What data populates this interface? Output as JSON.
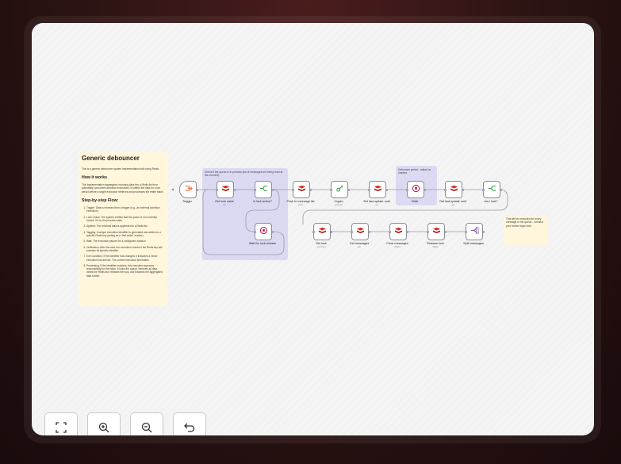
{
  "notes": {
    "main": {
      "title": "Generic debouncer",
      "intro": "This is a generic debouncer system implementation built using Redis.",
      "how_title": "How it works",
      "how_body": "This implementation aggregates incoming data into a Redis list from potentially concurrent workflow executions. It buffers the data for a set period before a single execution retrieves and processes the entire batch.",
      "steps_title": "Step-by-step Flow:",
      "steps": [
        "Trigger: Data is received from a trigger (e.g., an external workflow execution).",
        "Lock Check: The system verifies that the queue is not currently locked. If it is, the process waits.",
        "Append: The received data is appended to a Redis list.",
        "Tagging: A unique execution identifier is generated and written to a specific Redis key (acting as a \"last writer\" marker).",
        "Wait: The execution pauses for a configured duration.",
        "Verification: After the wait, the execution checks if the Redis key still contains its specific identifier.",
        "Exit Condition: If the identifier has changed, it indicates a newer execution has arrived. The current execution terminates.",
        "Processing: If the identifier matches, this execution assumes responsibility for the batch. It locks the queue, retrieves all data, clears the Redis list, releases the lock, and forwards the aggregated data further."
      ]
    },
    "queue_group": "Check if the queue is in process (list of messages are being read at the moment)",
    "wait_group": "Debounce period - adjust as needed",
    "final": "This will be executed for every message in the queue - connect your further logic here"
  },
  "nodes": [
    {
      "id": "trigger",
      "label": "Trigger",
      "sub": "",
      "icon": "trigger-icon"
    },
    {
      "id": "get-lock",
      "label": "Get lock value",
      "sub": "get",
      "icon": "redis-icon"
    },
    {
      "id": "is-lock-active",
      "label": "Is lock active?",
      "sub": "",
      "icon": "if-icon"
    },
    {
      "id": "wait-lock",
      "label": "Wait for lock release",
      "sub": "",
      "icon": "wait-icon"
    },
    {
      "id": "push",
      "label": "Push to message list",
      "sub": "push",
      "icon": "redis-icon"
    },
    {
      "id": "crypto",
      "label": "Crypto",
      "sub": "generate",
      "icon": "key-icon"
    },
    {
      "id": "set-last-update",
      "label": "Set last update uuid",
      "sub": "set",
      "icon": "redis-icon"
    },
    {
      "id": "wait",
      "label": "Wait",
      "sub": "",
      "icon": "wait-icon"
    },
    {
      "id": "get-last-update",
      "label": "Get last update uuid",
      "sub": "get",
      "icon": "redis-icon"
    },
    {
      "id": "am-i-last",
      "label": "Am I last?",
      "sub": "",
      "icon": "if-icon"
    },
    {
      "id": "set-lock",
      "label": "Set lock",
      "sub": "increment",
      "icon": "redis-icon"
    },
    {
      "id": "get-messages",
      "label": "Get messages",
      "sub": "get",
      "icon": "redis-icon"
    },
    {
      "id": "clear-messages",
      "label": "Clear messages",
      "sub": "delete",
      "icon": "redis-icon"
    },
    {
      "id": "release-lock",
      "label": "Release lock",
      "sub": "delete",
      "icon": "redis-icon"
    },
    {
      "id": "split",
      "label": "Split messages",
      "sub": "",
      "icon": "split-icon"
    }
  ],
  "labels": {
    "trigger_hint": "Trigger"
  },
  "controls": [
    {
      "name": "fit-view-button",
      "icon": "fit-view-icon"
    },
    {
      "name": "zoom-in-button",
      "icon": "zoom-in-icon"
    },
    {
      "name": "zoom-out-button",
      "icon": "zoom-out-icon"
    },
    {
      "name": "undo-button",
      "icon": "undo-icon"
    }
  ],
  "colors": {
    "redis": "#d9281f",
    "if": "#3a9a4a",
    "wait": "#c2185b",
    "trigger": "#ef6c3a",
    "split": "#7b5ea7",
    "key": "#3a9a4a"
  }
}
